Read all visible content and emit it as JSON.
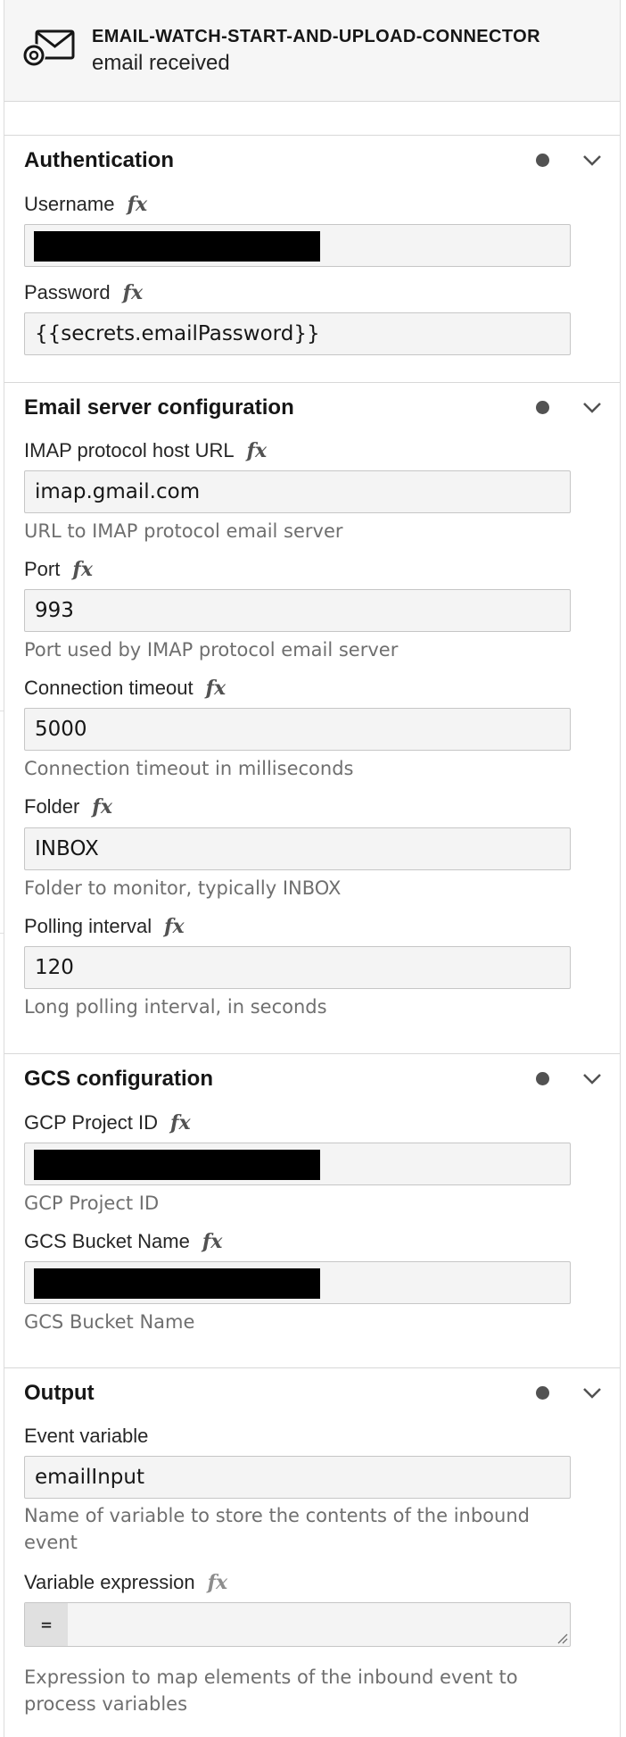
{
  "header": {
    "title": "EMAIL-WATCH-START-AND-UPLOAD-CONNECTOR",
    "subtitle": "email received",
    "icon": "at-envelope-icon"
  },
  "fx_symbol": "fx",
  "groups": {
    "authentication": {
      "title": "Authentication",
      "fields": {
        "username": {
          "label": "Username",
          "value": ""
        },
        "password": {
          "label": "Password",
          "value": "{{secrets.emailPassword}}"
        }
      }
    },
    "email_server": {
      "title": "Email server configuration",
      "fields": {
        "host": {
          "label": "IMAP protocol host URL",
          "value": "imap.gmail.com",
          "help": "URL to IMAP protocol email server"
        },
        "port": {
          "label": "Port",
          "value": "993",
          "help": "Port used by IMAP protocol email server"
        },
        "timeout": {
          "label": "Connection timeout",
          "value": "5000",
          "help": "Connection timeout in milliseconds"
        },
        "folder": {
          "label": "Folder",
          "value": "INBOX",
          "help": "Folder to monitor, typically INBOX"
        },
        "polling": {
          "label": "Polling interval",
          "value": "120",
          "help": "Long polling interval, in seconds"
        }
      }
    },
    "gcs": {
      "title": "GCS configuration",
      "fields": {
        "project_id": {
          "label": "GCP Project ID",
          "value": "",
          "help": "GCP Project ID"
        },
        "bucket": {
          "label": "GCS Bucket Name",
          "value": "",
          "help": "GCS Bucket Name"
        }
      }
    },
    "output": {
      "title": "Output",
      "fields": {
        "event_variable": {
          "label": "Event variable",
          "value": "emailInput",
          "help": "Name of variable to store the contents of the inbound event"
        },
        "variable_expression": {
          "label": "Variable expression",
          "prefix": "=",
          "value": "",
          "help": "Expression to map elements of the inbound event to process variables"
        }
      }
    }
  },
  "colors": {
    "header_bg": "#f6f6f6",
    "input_bg": "#f4f4f4",
    "help_text": "#6f6f6f",
    "dot": "#525252",
    "border": "#d8d8d8"
  }
}
